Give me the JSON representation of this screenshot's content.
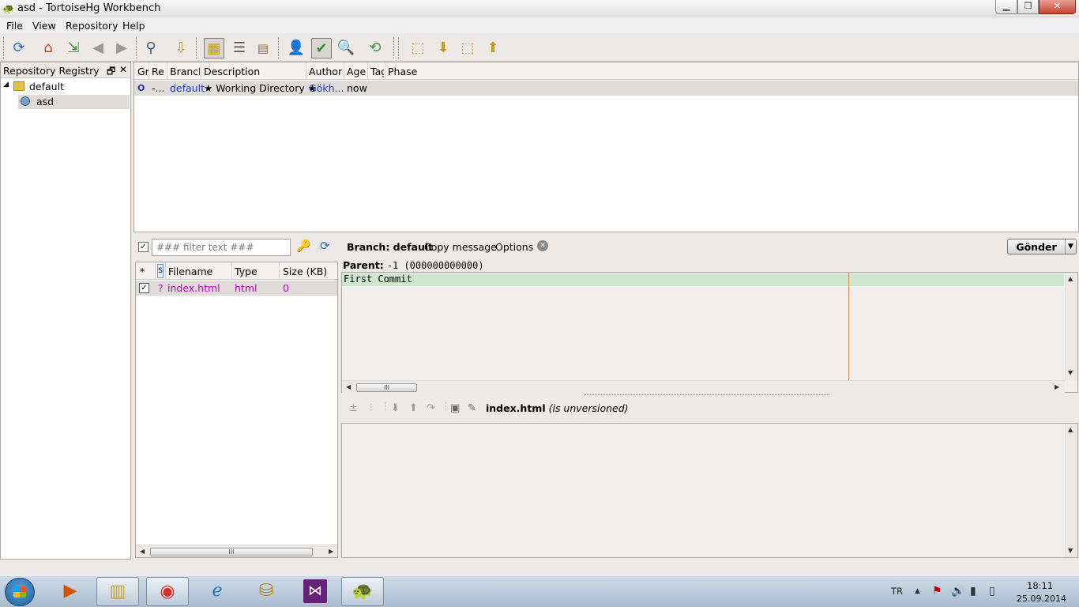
{
  "window": {
    "title": "asd - TortoiseHg Workbench",
    "min": "▁",
    "max": "❐",
    "close": "✕"
  },
  "menu": [
    "File",
    "View",
    "Repository",
    "Help"
  ],
  "toolbar_icons": [
    "refresh-icon",
    "home-icon",
    "goto-icon",
    "back-icon",
    "forward-icon",
    "search-icon",
    "pull-icon",
    "revision-details-icon",
    "commit-list-icon",
    "log-icon",
    "manifest-icon",
    "commit-icon",
    "search-repo-icon",
    "sync-icon",
    "incoming-icon",
    "pull-changes-icon",
    "outgoing-icon",
    "push-icon"
  ],
  "registry": {
    "title": "Repository Registry",
    "float_btn": "🗗",
    "close_btn": "✕",
    "groups": [
      {
        "label": "default",
        "repos": [
          "asd"
        ]
      }
    ]
  },
  "revtable": {
    "columns": [
      "Gr",
      "Re",
      "Branch",
      "Description",
      "Author",
      "Age",
      "Tag",
      "Phase"
    ],
    "rows": [
      {
        "graph": "O",
        "rev": "-...",
        "branch": "default",
        "description": "★ Working Directory ★",
        "author": "Gökh...",
        "age": "now",
        "tag": "",
        "phase": ""
      }
    ]
  },
  "filterbar": {
    "checked": "✓",
    "placeholder": "### filter text ###",
    "branch": "Branch: default",
    "copy_message": "Copy message",
    "options": "Options",
    "clear": "✕",
    "send": "Gönder",
    "send_arrow": "▼"
  },
  "filelist": {
    "columns": [
      "*",
      "S",
      "Filename",
      "Type",
      "Size (KB)"
    ],
    "rows": [
      {
        "checked": "✓",
        "status": "?",
        "filename": "index.html",
        "type": "html",
        "size": "0"
      }
    ],
    "scroll_thumb": "III"
  },
  "commit": {
    "parent_label": "Parent:",
    "parent_value": "-1 (000000000000)",
    "message": "First Commit",
    "scroll_thumb": "III"
  },
  "diff": {
    "filename": "index.html",
    "status": "(is unversioned)"
  },
  "taskbar": {
    "apps": [
      "media-player-icon",
      "file-explorer-icon",
      "chrome-icon",
      "internet-explorer-icon",
      "db-tool-icon",
      "visual-studio-icon",
      "tortoisehg-icon"
    ],
    "lang": "TR",
    "time": "18:11",
    "date": "25.09.2014"
  }
}
